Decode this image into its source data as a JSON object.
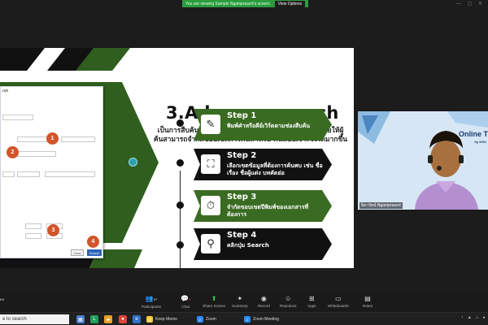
{
  "share_banner": {
    "text": "You are viewing Sample Ngamprasert's screen",
    "button": "View Options"
  },
  "slide": {
    "title": "3.Advance search",
    "subtitle": "เป็นการสืบค้นขั้นสูง ซึ่งมีเทคนิคหรือรูปแบบการค้นที่จะช่วยให้ผู้ค้นสามารถจำกัดขอบเขตการค้นหาหรือ ค้นแบบเจาะจงได้มากขึ้น",
    "accent_color": "#2f5e1e",
    "steps": [
      {
        "title": "Step 1",
        "desc": "พิมพ์คำหรือคีย์เวิร์ดตามช่องสืบค้น",
        "icon": "edit-note-icon",
        "color": "#3a6b22"
      },
      {
        "title": "Step 2",
        "desc": "เลือกเขตข้อมูลที่ต้องการค้นพบ เช่น ชื่อเรื่อง ชื่อผู้แต่ง บทคัดย่อ",
        "icon": "network-icon",
        "color": "#111111"
      },
      {
        "title": "Step 3",
        "desc": "จำกัดขอบเขตปีพิมพ์ของเอกสารที่ต้องการ",
        "icon": "clock-icon",
        "color": "#3a6b22"
      },
      {
        "title": "Step 4",
        "desc": "คลิกปุ่ม Search",
        "icon": "magnifier-icon",
        "color": "#111111"
      }
    ],
    "form": {
      "heading": "rch",
      "badges": [
        "1",
        "2",
        "3",
        "4"
      ],
      "cancel_label": "Clear",
      "search_label": "Search"
    }
  },
  "video": {
    "name": "ธิดารัตน์ Ngamprasert",
    "brand": "Online T",
    "brand_sub": "by KHU"
  },
  "toolbar": {
    "left_label": "eo",
    "participants_count": "57",
    "chat_count": "3",
    "items": [
      "Participants",
      "Chat",
      "Share Screen",
      "Summary",
      "Record",
      "Reactions",
      "Apps",
      "Whiteboards",
      "Notes"
    ]
  },
  "taskbar": {
    "search_placeholder": "e to search",
    "apps": [
      "Keep Memo",
      "Zoom",
      "Zoom Meeting"
    ]
  }
}
